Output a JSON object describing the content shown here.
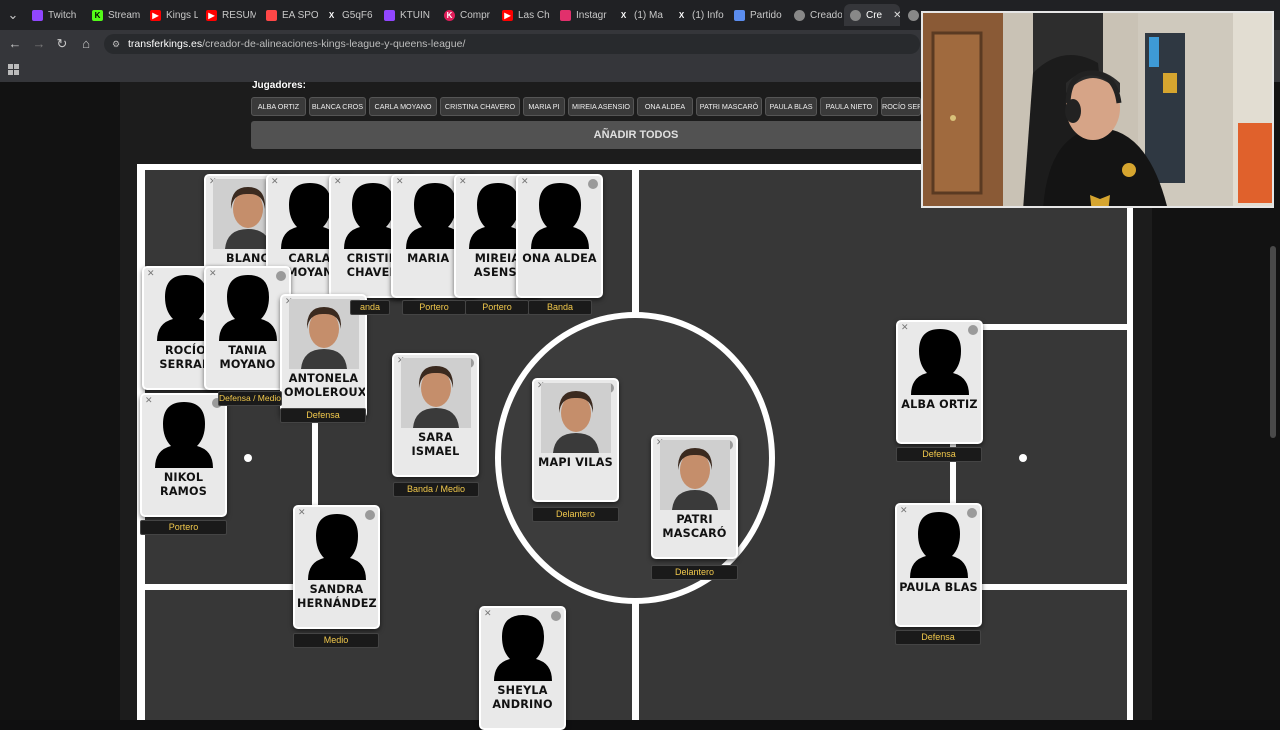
{
  "browser": {
    "tabs": [
      {
        "label": "Twitch",
        "icon": "twitch-icon",
        "color": "#9146ff"
      },
      {
        "label": "Stream",
        "icon": "kick-icon",
        "color": "#53fc18"
      },
      {
        "label": "Kings L",
        "icon": "youtube-icon",
        "color": "#ff0000"
      },
      {
        "label": "RESUM",
        "icon": "youtube-icon",
        "color": "#ff0000"
      },
      {
        "label": "EA SPO",
        "icon": "ea-icon",
        "color": "#ff4747"
      },
      {
        "label": "G5qF6",
        "icon": "x-icon",
        "color": "#000000"
      },
      {
        "label": "KTUIN",
        "icon": "twitch-icon",
        "color": "#9146ff"
      },
      {
        "label": "Compr",
        "icon": "kick-icon",
        "color": "#e01e5a"
      },
      {
        "label": "Las Ch",
        "icon": "youtube-icon",
        "color": "#ff0000"
      },
      {
        "label": "Instagr",
        "icon": "instagram-icon",
        "color": "#e1306c"
      },
      {
        "label": "(1) Ma",
        "icon": "x-icon",
        "color": "#000000"
      },
      {
        "label": "(1) Info",
        "icon": "x-icon",
        "color": "#000000"
      },
      {
        "label": "Partido",
        "icon": "game-icon",
        "color": "#5b8def"
      },
      {
        "label": "Creado",
        "icon": "site-icon",
        "color": "#888888"
      },
      {
        "label": "Cre",
        "icon": "site-icon",
        "color": "#888888"
      }
    ],
    "url_host": "transferkings.es",
    "url_path": "/creador-de-alineaciones-kings-league-y-queens-league/"
  },
  "page": {
    "players_title": "Jugadores:",
    "chips": [
      "ALBA ORTIZ",
      "BLANCA CROS",
      "CARLA MOYANO",
      "CRISTINA CHAVERO",
      "MARIA PI",
      "MIREIA ASENSIO",
      "ONA ALDEA",
      "PATRI MASCARÓ",
      "PAULA BLAS",
      "PAULA NIETO",
      "ROCÍO SER"
    ],
    "add_all": "AÑADIR TODOS"
  },
  "cards": [
    {
      "name": "BLANC",
      "photo": true
    },
    {
      "name": "CARLA MOYAN",
      "photo": false
    },
    {
      "name": "CRISTIN CHAVER",
      "photo": false
    },
    {
      "name": "MARIA P",
      "photo": false
    },
    {
      "name": "MIREIA ASENSI",
      "photo": false
    },
    {
      "name": "ONA ALDEA",
      "photo": false
    },
    {
      "name": "ROCÍO SERRAN",
      "photo": false
    },
    {
      "name": "TANIA MOYANO",
      "photo": false
    },
    {
      "name": "ANTONELA OMOLEROUX",
      "photo": true
    },
    {
      "name": "SARA ISMAEL",
      "photo": true
    },
    {
      "name": "MAPI VILAS",
      "photo": true
    },
    {
      "name": "PATRI MASCARÓ",
      "photo": true
    },
    {
      "name": "NIKOL RAMOS",
      "photo": false
    },
    {
      "name": "SANDRA HERNÁNDEZ",
      "photo": false
    },
    {
      "name": "SHEYLA ANDRINO",
      "photo": false
    },
    {
      "name": "ALBA ORTIZ",
      "photo": false
    },
    {
      "name": "PAULA BLAS",
      "photo": false
    }
  ],
  "positions": [
    "anda",
    "Portero",
    "Portero",
    "Banda",
    "Defensa / Medio",
    "Defensa",
    "Banda / Medio",
    "Delantero",
    "Delantero",
    "Portero",
    "Medio",
    "Defensa",
    "Defensa"
  ]
}
